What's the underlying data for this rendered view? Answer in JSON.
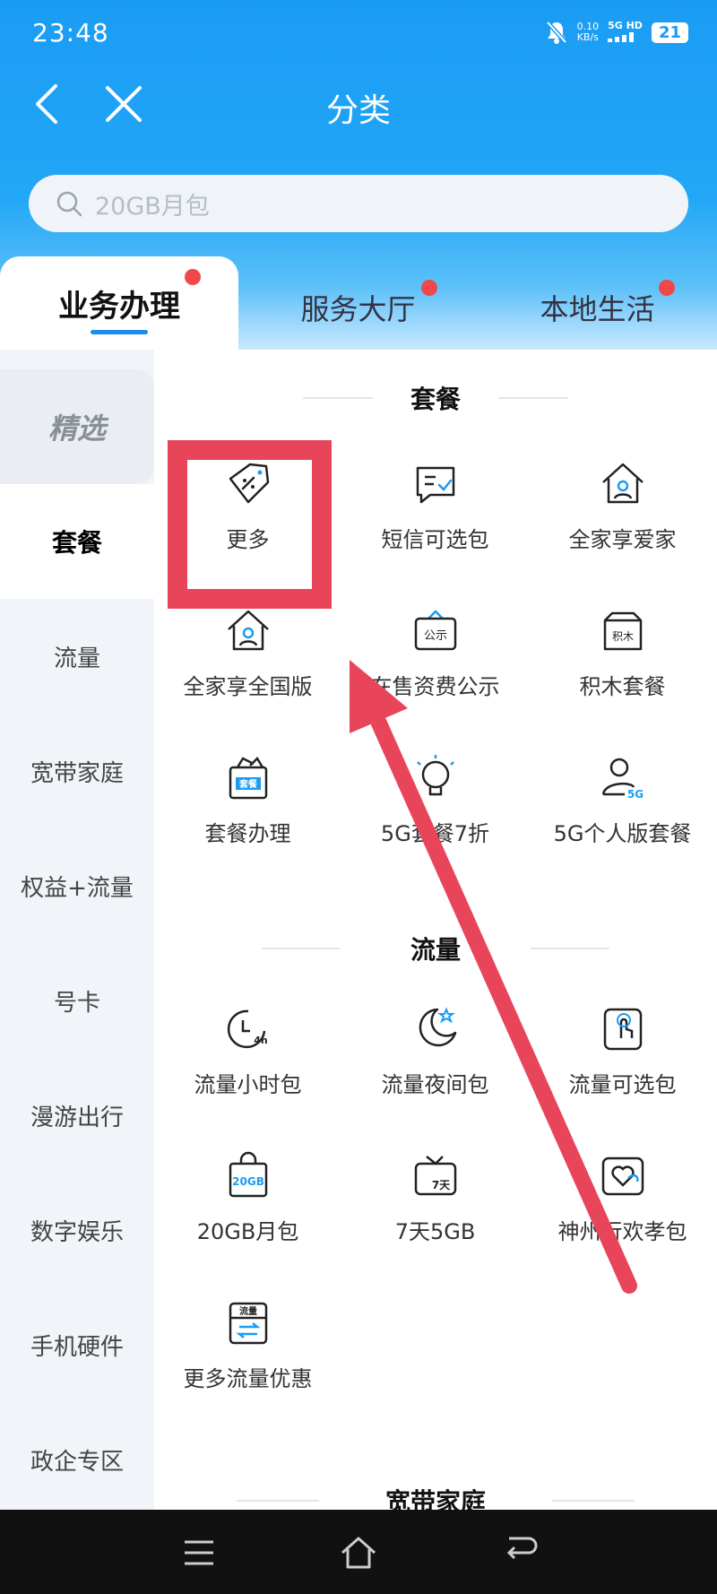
{
  "status_bar": {
    "time": "23:48",
    "net_speed_value": "0.10",
    "net_speed_unit": "KB/s",
    "signal_label": "5G HD",
    "battery": "21"
  },
  "nav": {
    "title": "分类",
    "back_icon": "chevron-left-icon",
    "close_icon": "close-icon"
  },
  "search": {
    "placeholder": "20GB月包"
  },
  "tabs": [
    {
      "label": "业务办理",
      "active": true
    },
    {
      "label": "服务大厅"
    },
    {
      "label": "本地生活"
    }
  ],
  "sidebar": {
    "items": [
      {
        "label": "精选"
      },
      {
        "label": "套餐",
        "active": true
      },
      {
        "label": "流量"
      },
      {
        "label": "宽带家庭"
      },
      {
        "label": "权益+流量"
      },
      {
        "label": "号卡"
      },
      {
        "label": "漫游出行"
      },
      {
        "label": "数字娱乐"
      },
      {
        "label": "手机硬件"
      },
      {
        "label": "政企专区"
      }
    ]
  },
  "sections": [
    {
      "title": "套餐",
      "items": [
        {
          "label": "更多"
        },
        {
          "label": "短信可选包"
        },
        {
          "label": "全家享爱家"
        },
        {
          "label": "全家享全国版"
        },
        {
          "label": "在售资费公示"
        },
        {
          "label": "积木套餐"
        },
        {
          "label": "套餐办理"
        },
        {
          "label": "5G套餐7折"
        },
        {
          "label": "5G个人版套餐"
        }
      ]
    },
    {
      "title": "流量",
      "items": [
        {
          "label": "流量小时包"
        },
        {
          "label": "流量夜间包"
        },
        {
          "label": "流量可选包"
        },
        {
          "label": "20GB月包"
        },
        {
          "label": "7天5GB"
        },
        {
          "label": "神州行欢孝包"
        },
        {
          "label": "更多流量优惠"
        }
      ]
    },
    {
      "title": "宽带家庭"
    }
  ],
  "icon_text": {
    "notice": "公示",
    "blocks": "积木",
    "package": "套餐",
    "five_g": "5G",
    "four_h": "4h",
    "twenty_gb": "20GB",
    "seven_day": "7天",
    "flow": "流量"
  },
  "colors": {
    "primary": "#1a9cf4",
    "badge": "#f04848",
    "annotation": "#e8455a"
  }
}
